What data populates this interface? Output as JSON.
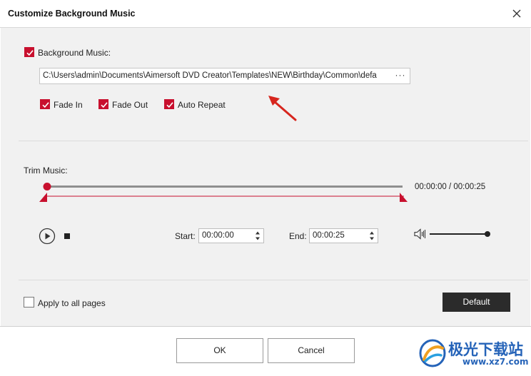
{
  "window": {
    "title": "Customize Background Music"
  },
  "music": {
    "background_label": "Background Music:",
    "background_checked": true,
    "path": "C:\\Users\\admin\\Documents\\Aimersoft DVD Creator\\Templates\\NEW\\Birthday\\Common\\defa",
    "browse_label": "···",
    "fade_in_label": "Fade In",
    "fade_in_checked": true,
    "fade_out_label": "Fade Out",
    "fade_out_checked": true,
    "auto_repeat_label": "Auto Repeat",
    "auto_repeat_checked": true
  },
  "trim": {
    "label": "Trim Music:",
    "time_display": "00:00:00 / 00:00:25",
    "start_label": "Start:",
    "start_value": "00:00:00",
    "end_label": "End:",
    "end_value": "00:00:25",
    "playhead_fraction": 0,
    "volume_fraction": 1
  },
  "bottom": {
    "apply_all_label": "Apply to all pages",
    "apply_all_checked": false,
    "default_label": "Default"
  },
  "footer": {
    "ok_label": "OK",
    "cancel_label": "Cancel"
  },
  "watermark": {
    "brand": "极光下载站",
    "url": "www.xz7.com"
  },
  "colors": {
    "accent": "#c8102e",
    "annotation_arrow": "#d7261e",
    "dark_button": "#2b2b2b",
    "watermark": "#2563b8"
  },
  "icons": {
    "close": "close-icon",
    "play": "play-icon",
    "stop": "stop-icon",
    "volume": "volume-icon",
    "check": "checkmark-icon"
  }
}
